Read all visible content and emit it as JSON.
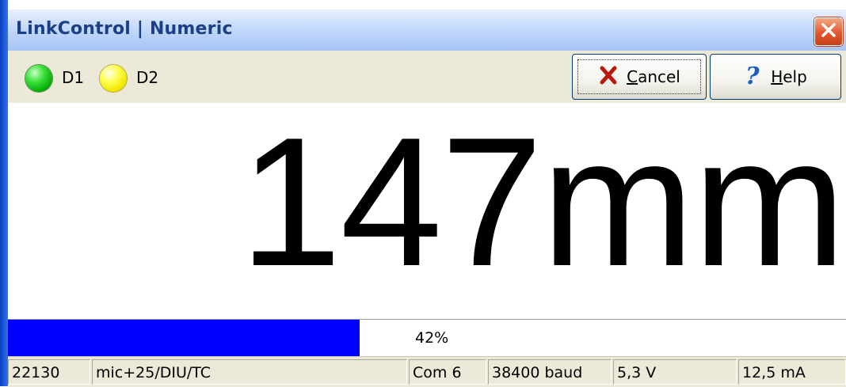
{
  "window": {
    "title": "LinkControl | Numeric"
  },
  "toolbar": {
    "indicators": [
      {
        "label": "D1",
        "color": "#22cc22"
      },
      {
        "label": "D2",
        "color": "#ffee00"
      }
    ],
    "cancel_prefix": "",
    "cancel_underline": "C",
    "cancel_rest": "ancel",
    "help_underline": "H",
    "help_rest": "elp"
  },
  "display": {
    "reading": "147mm"
  },
  "progress": {
    "value": 0.42,
    "text": "42%",
    "color": "#0000ff"
  },
  "statusbar": {
    "cells": [
      "22130",
      "mic+25/DIU/TC",
      "Com 6",
      "38400 baud",
      "5,3 V",
      "12,5 mA"
    ]
  }
}
